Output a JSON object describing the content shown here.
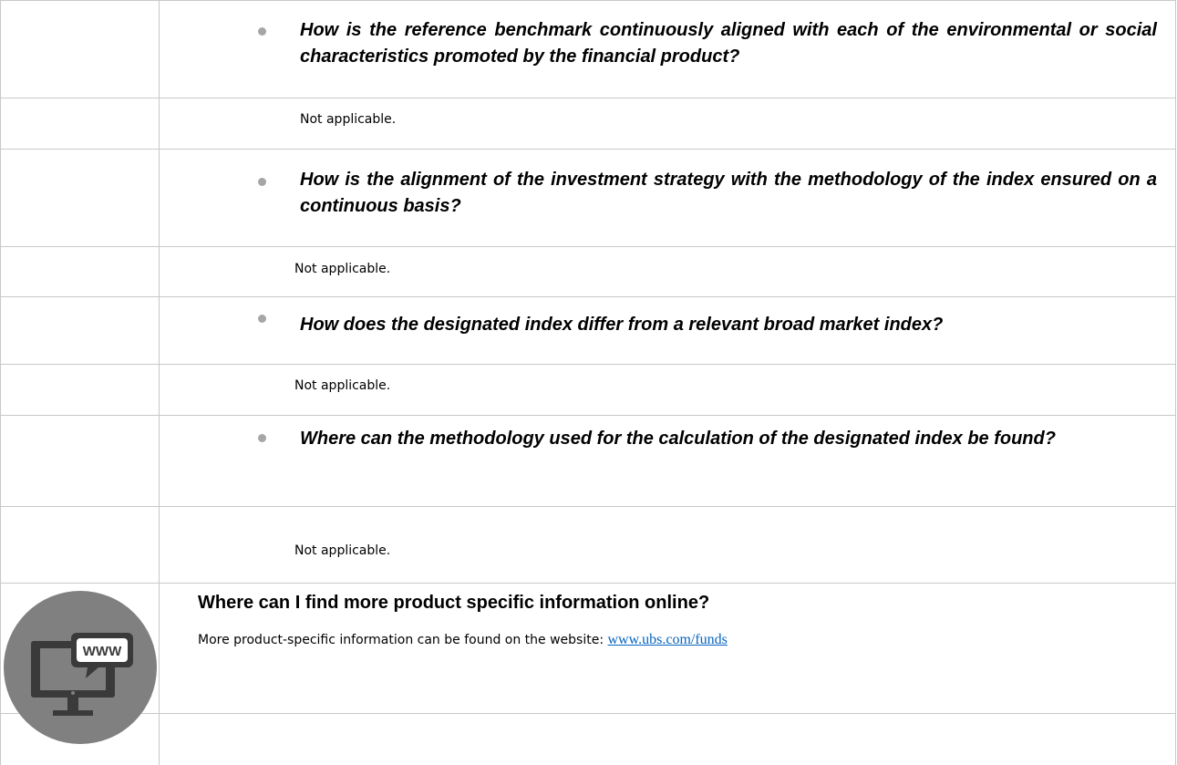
{
  "sections": [
    {
      "question": "How is the reference benchmark continuously aligned with each of the environmental or social characteristics promoted by the financial product?",
      "answer": "Not applicable."
    },
    {
      "question": "How is the alignment of the investment strategy with the methodology of the index ensured on a continuous basis?",
      "answer": "Not applicable."
    },
    {
      "question": "How does the designated index differ from a relevant broad market index?",
      "answer": "Not applicable."
    },
    {
      "question": "Where can the methodology used for the calculation of the designated index be found?",
      "answer": "Not applicable."
    }
  ],
  "online_info": {
    "heading": "Where can I find more product specific information online?",
    "text": "More product-specific information can be found on the website: ",
    "link_text": "www.ubs.com/funds",
    "icon_label": "WWW"
  },
  "colors": {
    "border": "#c8c8c8",
    "bullet": "#a6a6a6",
    "icon_circle": "#808080",
    "icon_dark": "#3a3a3a",
    "link": "#0563c1"
  }
}
